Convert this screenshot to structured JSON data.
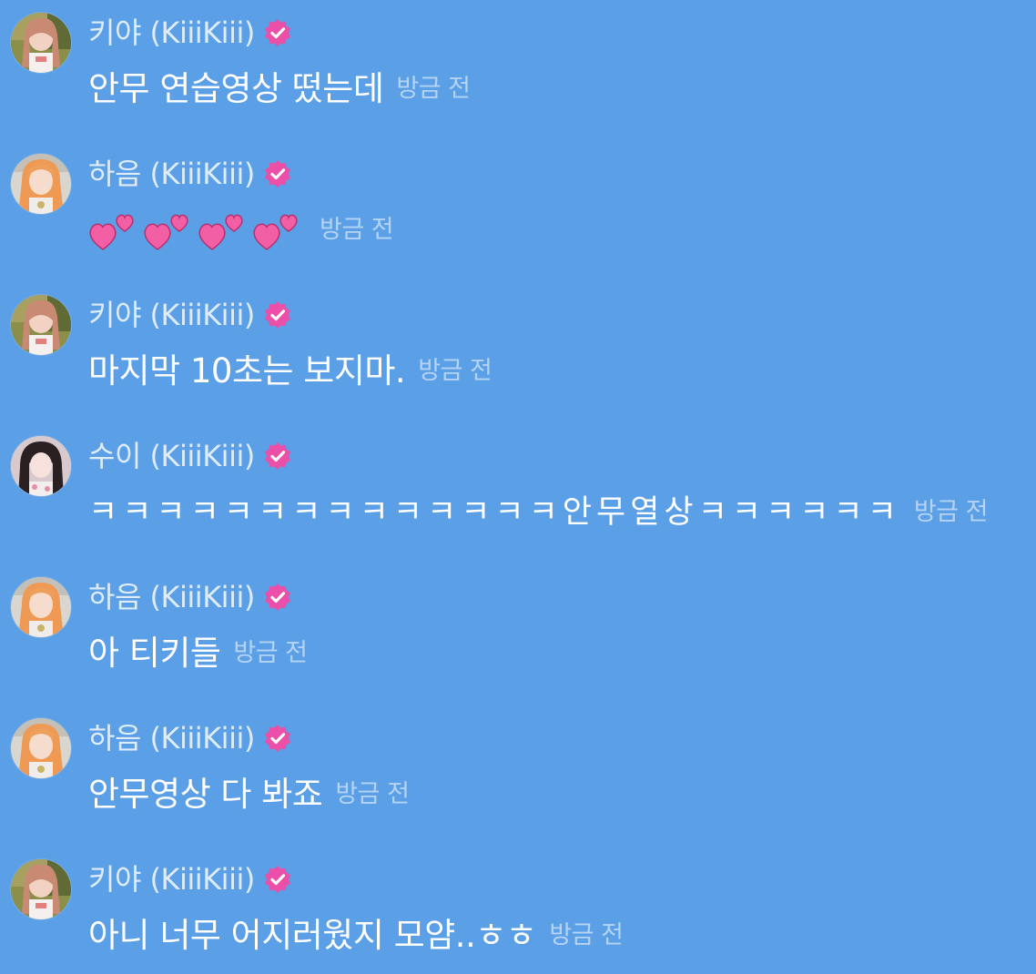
{
  "colors": {
    "background": "#5b9fe6",
    "verified_badge": "#ec4fa8",
    "heart": "#f35fa4"
  },
  "messages": [
    {
      "sender": "키야 (KiiiKiii)",
      "avatar": "kiya",
      "verified_icon": "verified-badge-icon",
      "text": "안무 연습영상 떴는데",
      "time": "방금 전"
    },
    {
      "sender": "하음 (KiiiKiii)",
      "avatar": "haeum",
      "verified_icon": "verified-badge-icon",
      "text": "💕💕💕💕",
      "emoji_icon": "two-hearts-icon",
      "time": "방금 전"
    },
    {
      "sender": "키야 (KiiiKiii)",
      "avatar": "kiya",
      "verified_icon": "verified-badge-icon",
      "text": "마지막 10초는 보지마.",
      "time": "방금 전"
    },
    {
      "sender": "수이 (KiiiKiii)",
      "avatar": "sui",
      "verified_icon": "verified-badge-icon",
      "text": "ㅋㅋㅋㅋㅋㅋㅋㅋㅋㅋㅋㅋㅋㅋ안무열상ㅋㅋㅋㅋㅋㅋ",
      "time": "방금 전"
    },
    {
      "sender": "하음 (KiiiKiii)",
      "avatar": "haeum",
      "verified_icon": "verified-badge-icon",
      "text": "아 티키들",
      "time": "방금 전"
    },
    {
      "sender": "하음 (KiiiKiii)",
      "avatar": "haeum",
      "verified_icon": "verified-badge-icon",
      "text": "안무영상 다 봐죠",
      "time": "방금 전"
    },
    {
      "sender": "키야 (KiiiKiii)",
      "avatar": "kiya",
      "verified_icon": "verified-badge-icon",
      "text": "아니 너무 어지러웠지 모얌..ㅎㅎ",
      "time": "방금 전"
    }
  ]
}
